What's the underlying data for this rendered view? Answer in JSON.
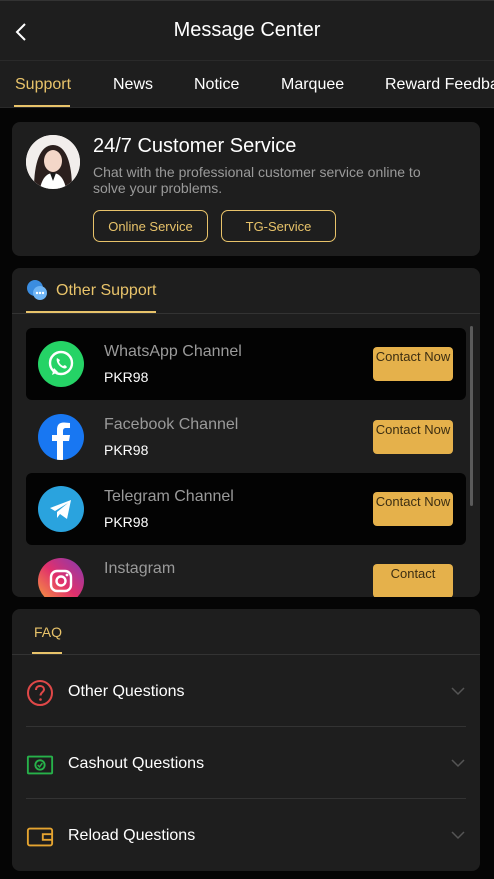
{
  "header": {
    "title": "Message Center"
  },
  "tabs": [
    "Support",
    "News",
    "Notice",
    "Marquee",
    "Reward Feedback"
  ],
  "customer_service": {
    "title": "24/7 Customer Service",
    "description": "Chat with the professional customer service online to solve your problems.",
    "online_button": "Online Service",
    "tg_button": "TG-Service"
  },
  "other_support": {
    "title": "Other Support",
    "channels": [
      {
        "name": "WhatsApp Channel",
        "amount": "PKR98",
        "button": "Contact Now"
      },
      {
        "name": "Facebook Channel",
        "amount": "PKR98",
        "button": "Contact Now"
      },
      {
        "name": "Telegram Channel",
        "amount": "PKR98",
        "button": "Contact Now"
      },
      {
        "name": "Instagram",
        "amount": "",
        "button": "Contact"
      }
    ]
  },
  "faq": {
    "title": "FAQ",
    "items": [
      "Other Questions",
      "Cashout Questions",
      "Reload Questions"
    ]
  },
  "colors": {
    "accent": "#e8c36a",
    "button_fill": "#e5b14b",
    "card": "#1e1e1e",
    "background": "#050505"
  }
}
